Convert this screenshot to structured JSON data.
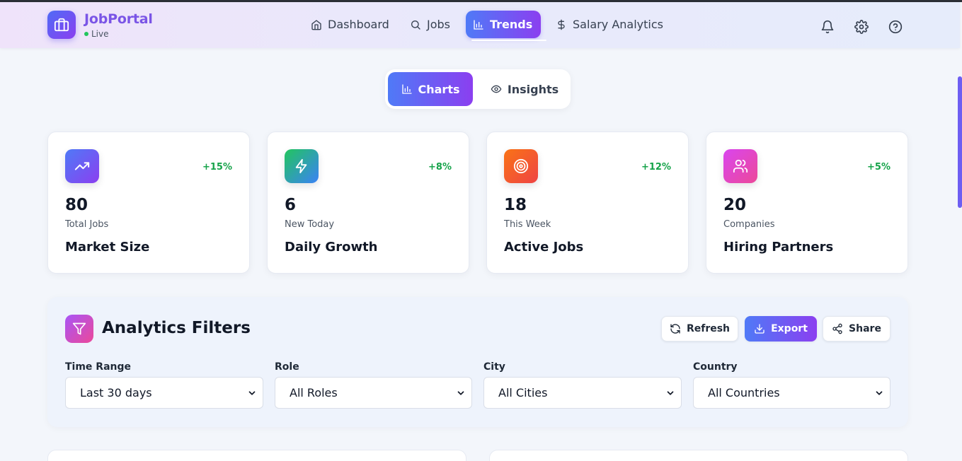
{
  "header": {
    "app_name": "JobPortal",
    "status": "Live",
    "nav": [
      {
        "label": "Dashboard",
        "icon": "home-icon"
      },
      {
        "label": "Jobs",
        "icon": "search-icon"
      },
      {
        "label": "Trends",
        "icon": "bar-chart-icon",
        "active": true
      },
      {
        "label": "Salary Analytics",
        "icon": "dollar-icon"
      }
    ],
    "icons": [
      "bell-icon",
      "gear-icon",
      "help-icon"
    ]
  },
  "view_toggle": {
    "options": [
      {
        "label": "Charts",
        "icon": "bar-chart-icon",
        "active": true
      },
      {
        "label": "Insights",
        "icon": "eye-icon"
      }
    ]
  },
  "stats": [
    {
      "value": "80",
      "sub": "Total Jobs",
      "label": "Market Size",
      "change": "+15%",
      "icon": "trending-up-icon",
      "color_from": "#4f7af7",
      "color_to": "#8b3ff0"
    },
    {
      "value": "6",
      "sub": "New Today",
      "label": "Daily Growth",
      "change": "+8%",
      "icon": "lightning-icon",
      "color_from": "#22c55e",
      "color_to": "#3b82f6"
    },
    {
      "value": "18",
      "sub": "This Week",
      "label": "Active Jobs",
      "change": "+12%",
      "icon": "target-icon",
      "color_from": "#f97316",
      "color_to": "#ef4444"
    },
    {
      "value": "20",
      "sub": "Companies",
      "label": "Hiring Partners",
      "change": "+5%",
      "icon": "users-icon",
      "color_from": "#d946ef",
      "color_to": "#ec4899"
    }
  ],
  "filters": {
    "title": "Analytics Filters",
    "buttons": {
      "refresh": "Refresh",
      "export": "Export",
      "share": "Share"
    },
    "fields": [
      {
        "label": "Time Range",
        "value": "Last 30 days"
      },
      {
        "label": "Role",
        "value": "All Roles"
      },
      {
        "label": "City",
        "value": "All Cities"
      },
      {
        "label": "Country",
        "value": "All Countries"
      }
    ]
  },
  "colors": {
    "accent_from": "#4f7af7",
    "accent_to": "#8b3ff0",
    "positive": "#16a34a"
  }
}
